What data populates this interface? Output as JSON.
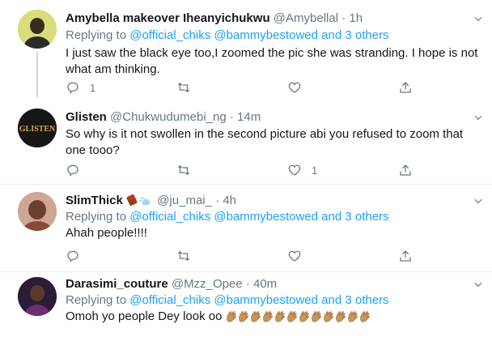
{
  "tweets": [
    {
      "name": "Amybella makeover Iheanyichukwu",
      "handle": "@Amybellal",
      "dot": "·",
      "time": "1h",
      "reply_prefix": "Replying to",
      "reply_to": "@official_chiks @bammybestowed and 3 others",
      "text": "I just saw the black eye too,I zoomed the pic she was stranding. I hope is not what am thinking.",
      "reply_count": "1",
      "retweet_count": "",
      "like_count": ""
    },
    {
      "name": "Glisten",
      "handle": "@Chukwudumebi_ng",
      "dot": "·",
      "time": "14m",
      "avatar_text": "GLISTEN",
      "text": "So why is it not swollen in the second picture abi you refused to zoom that one tooo?",
      "reply_count": "",
      "retweet_count": "",
      "like_count": "1"
    },
    {
      "name": "SlimThick",
      "handle": "@ju_mai_",
      "dot": "·",
      "time": "4h",
      "reply_prefix": "Replying to",
      "reply_to": "@official_chiks @bammybestowed and 3 others",
      "text": "Ahah people!!!!",
      "reply_count": "",
      "retweet_count": "",
      "like_count": ""
    },
    {
      "name": "Darasimi_couture",
      "handle": "@Mzz_Opee",
      "dot": "·",
      "time": "40m",
      "reply_prefix": "Replying to",
      "reply_to": "@official_chiks @bammybestowed and 3 others",
      "text": "Omoh yo people Dey look oo",
      "emoji_count": 12
    }
  ],
  "colors": {
    "link": "#1da1f2",
    "secondary": "#657786",
    "separator": "#e6ecf0",
    "thread_line": "#ccd6dd"
  },
  "icons": [
    "reply-icon",
    "retweet-icon",
    "like-icon",
    "share-icon",
    "chevron-down-icon",
    "clapping-hands-emoji"
  ]
}
